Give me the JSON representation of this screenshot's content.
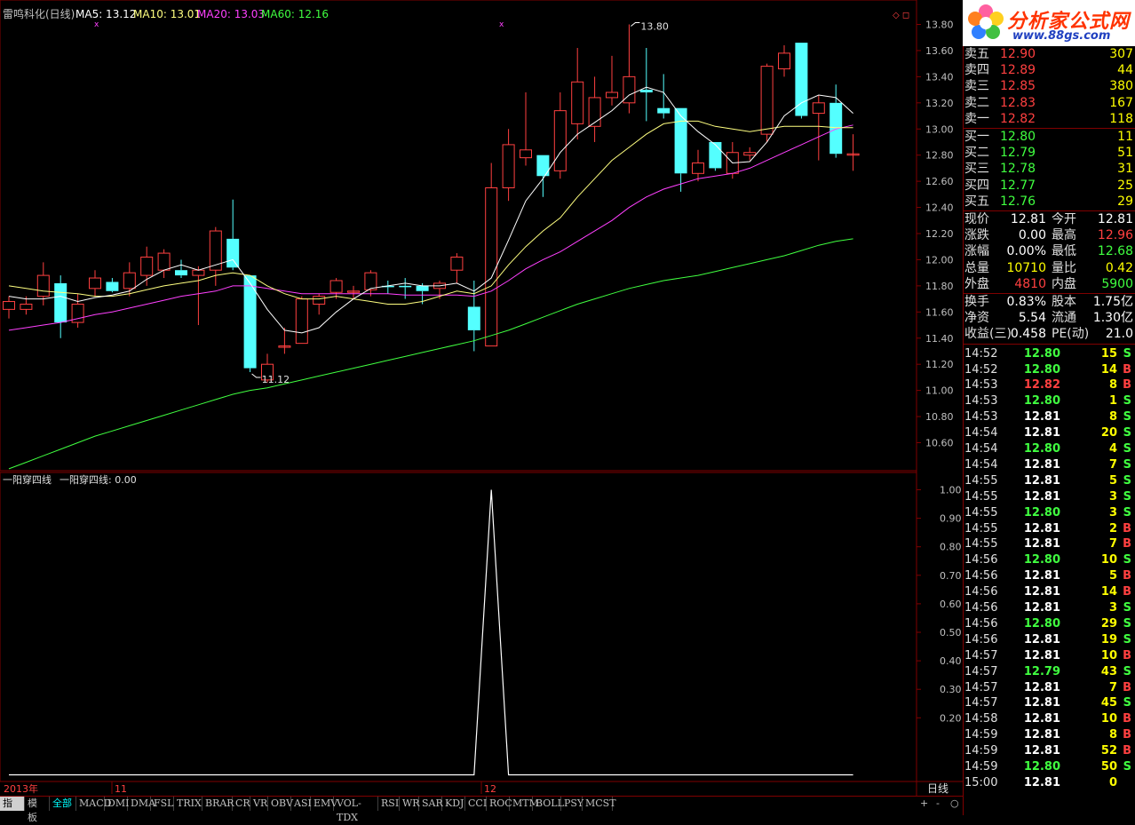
{
  "header": {
    "stock": "雷鸣科化(日线)",
    "ma5": "MA5: 13.12",
    "ma10": "MA10: 13.01",
    "ma20": "MA20: 13.03",
    "ma60": "MA60: 12.16",
    "marker": "◇ ◻"
  },
  "colors": {
    "up": "#ff4040",
    "down": "#54ffff",
    "ma5": "#ffffff",
    "ma10": "#ffff80",
    "ma20": "#ff40ff",
    "ma60": "#40ff40",
    "grid": "#800000"
  },
  "chart_data": [
    {
      "type": "candlestick",
      "title": "雷鸣科化(日线)",
      "ylim": [
        10.4,
        13.9
      ],
      "y_ticks": [
        "13.80",
        "13.60",
        "13.40",
        "13.20",
        "13.00",
        "12.80",
        "12.60",
        "12.40",
        "12.20",
        "12.00",
        "11.80",
        "11.60",
        "11.40",
        "11.20",
        "11.00",
        "10.80",
        "10.60"
      ],
      "annotations": [
        {
          "label": "13.80"
        },
        {
          "label": "11.12"
        }
      ],
      "candles": [
        {
          "o": 11.62,
          "h": 11.72,
          "l": 11.55,
          "c": 11.68
        },
        {
          "o": 11.62,
          "h": 11.72,
          "l": 11.58,
          "c": 11.66
        },
        {
          "o": 11.72,
          "h": 11.98,
          "l": 11.65,
          "c": 11.88
        },
        {
          "o": 11.82,
          "h": 11.88,
          "l": 11.4,
          "c": 11.52
        },
        {
          "o": 11.52,
          "h": 11.74,
          "l": 11.48,
          "c": 11.66
        },
        {
          "o": 11.78,
          "h": 11.92,
          "l": 11.72,
          "c": 11.86
        },
        {
          "o": 11.83,
          "h": 11.86,
          "l": 11.75,
          "c": 11.76
        },
        {
          "o": 11.78,
          "h": 11.98,
          "l": 11.72,
          "c": 11.9
        },
        {
          "o": 11.88,
          "h": 12.1,
          "l": 11.8,
          "c": 12.02
        },
        {
          "o": 11.92,
          "h": 12.08,
          "l": 11.86,
          "c": 12.05
        },
        {
          "o": 11.92,
          "h": 12.0,
          "l": 11.86,
          "c": 11.88
        },
        {
          "o": 11.88,
          "h": 11.95,
          "l": 11.5,
          "c": 11.92
        },
        {
          "o": 11.92,
          "h": 12.25,
          "l": 11.8,
          "c": 12.22
        },
        {
          "o": 12.16,
          "h": 12.46,
          "l": 11.92,
          "c": 11.94
        },
        {
          "o": 11.88,
          "h": 11.88,
          "l": 11.14,
          "c": 11.17
        },
        {
          "o": 11.08,
          "h": 11.28,
          "l": 11.06,
          "c": 11.2
        },
        {
          "o": 11.34,
          "h": 11.48,
          "l": 11.28,
          "c": 11.34
        },
        {
          "o": 11.36,
          "h": 11.72,
          "l": 11.36,
          "c": 11.7
        },
        {
          "o": 11.66,
          "h": 11.74,
          "l": 11.58,
          "c": 11.72
        },
        {
          "o": 11.75,
          "h": 11.86,
          "l": 11.7,
          "c": 11.84
        },
        {
          "o": 11.76,
          "h": 11.8,
          "l": 11.7,
          "c": 11.76
        },
        {
          "o": 11.77,
          "h": 11.92,
          "l": 11.72,
          "c": 11.9
        },
        {
          "o": 11.8,
          "h": 11.84,
          "l": 11.74,
          "c": 11.79
        },
        {
          "o": 11.8,
          "h": 11.86,
          "l": 11.7,
          "c": 11.79
        },
        {
          "o": 11.8,
          "h": 11.82,
          "l": 11.66,
          "c": 11.76
        },
        {
          "o": 11.78,
          "h": 11.84,
          "l": 11.7,
          "c": 11.82
        },
        {
          "o": 11.92,
          "h": 12.05,
          "l": 11.82,
          "c": 12.02
        },
        {
          "o": 11.64,
          "h": 11.84,
          "l": 11.3,
          "c": 11.46
        },
        {
          "o": 11.34,
          "h": 12.74,
          "l": 11.34,
          "c": 12.55
        },
        {
          "o": 12.55,
          "h": 13.0,
          "l": 12.45,
          "c": 12.88
        },
        {
          "o": 12.78,
          "h": 13.28,
          "l": 12.72,
          "c": 12.84
        },
        {
          "o": 12.8,
          "h": 12.8,
          "l": 12.48,
          "c": 12.64
        },
        {
          "o": 12.68,
          "h": 13.28,
          "l": 12.62,
          "c": 13.14
        },
        {
          "o": 13.04,
          "h": 13.62,
          "l": 12.92,
          "c": 13.36
        },
        {
          "o": 13.02,
          "h": 13.4,
          "l": 12.9,
          "c": 13.24
        },
        {
          "o": 13.24,
          "h": 13.56,
          "l": 13.18,
          "c": 13.28
        },
        {
          "o": 13.2,
          "h": 13.8,
          "l": 13.12,
          "c": 13.4
        },
        {
          "o": 13.3,
          "h": 13.62,
          "l": 13.06,
          "c": 13.28
        },
        {
          "o": 13.16,
          "h": 13.42,
          "l": 13.08,
          "c": 13.12
        },
        {
          "o": 13.16,
          "h": 13.16,
          "l": 12.52,
          "c": 12.66
        },
        {
          "o": 12.66,
          "h": 12.84,
          "l": 12.6,
          "c": 12.74
        },
        {
          "o": 12.9,
          "h": 12.9,
          "l": 12.68,
          "c": 12.7
        },
        {
          "o": 12.66,
          "h": 12.9,
          "l": 12.62,
          "c": 12.82
        },
        {
          "o": 12.8,
          "h": 12.86,
          "l": 12.76,
          "c": 12.82
        },
        {
          "o": 12.96,
          "h": 13.5,
          "l": 12.9,
          "c": 13.48
        },
        {
          "o": 13.46,
          "h": 13.64,
          "l": 13.4,
          "c": 13.58
        },
        {
          "o": 13.66,
          "h": 13.66,
          "l": 13.08,
          "c": 13.1
        },
        {
          "o": 13.12,
          "h": 13.26,
          "l": 12.76,
          "c": 13.2
        },
        {
          "o": 13.2,
          "h": 13.34,
          "l": 12.78,
          "c": 12.81
        },
        {
          "o": 12.81,
          "h": 12.96,
          "l": 12.68,
          "c": 12.81
        }
      ],
      "ma5": [
        11.72,
        11.7,
        11.7,
        11.72,
        11.68,
        11.71,
        11.73,
        11.76,
        11.85,
        11.92,
        11.96,
        11.92,
        11.96,
        12.0,
        11.82,
        11.62,
        11.46,
        11.44,
        11.48,
        11.6,
        11.7,
        11.78,
        11.8,
        11.82,
        11.8,
        11.8,
        11.82,
        11.76,
        11.86,
        12.15,
        12.45,
        12.62,
        12.82,
        12.96,
        13.05,
        13.14,
        13.26,
        13.32,
        13.28,
        13.1,
        12.98,
        12.88,
        12.74,
        12.75,
        12.9,
        13.1,
        13.2,
        13.26,
        13.24,
        13.12
      ],
      "ma10": [
        11.8,
        11.78,
        11.76,
        11.75,
        11.74,
        11.72,
        11.72,
        11.74,
        11.77,
        11.8,
        11.82,
        11.84,
        11.88,
        11.9,
        11.88,
        11.8,
        11.74,
        11.7,
        11.7,
        11.72,
        11.7,
        11.68,
        11.66,
        11.66,
        11.68,
        11.72,
        11.76,
        11.74,
        11.8,
        11.96,
        12.1,
        12.22,
        12.32,
        12.48,
        12.62,
        12.76,
        12.86,
        12.96,
        13.04,
        13.06,
        13.06,
        13.02,
        13.0,
        12.98,
        13.0,
        13.02,
        13.02,
        13.02,
        13.01,
        13.01
      ],
      "ma20": [
        11.46,
        11.48,
        11.5,
        11.52,
        11.55,
        11.58,
        11.6,
        11.63,
        11.66,
        11.69,
        11.72,
        11.74,
        11.76,
        11.8,
        11.8,
        11.78,
        11.76,
        11.74,
        11.74,
        11.74,
        11.74,
        11.74,
        11.74,
        11.73,
        11.73,
        11.73,
        11.73,
        11.72,
        11.76,
        11.84,
        11.93,
        12.0,
        12.06,
        12.14,
        12.22,
        12.3,
        12.4,
        12.48,
        12.54,
        12.58,
        12.62,
        12.64,
        12.66,
        12.7,
        12.76,
        12.82,
        12.88,
        12.94,
        13.0,
        13.03
      ],
      "ma60": [
        10.4,
        10.45,
        10.5,
        10.55,
        10.6,
        10.65,
        10.69,
        10.73,
        10.77,
        10.81,
        10.85,
        10.89,
        10.93,
        10.97,
        11.0,
        11.02,
        11.05,
        11.08,
        11.11,
        11.14,
        11.17,
        11.2,
        11.23,
        11.26,
        11.29,
        11.32,
        11.35,
        11.38,
        11.42,
        11.46,
        11.51,
        11.56,
        11.61,
        11.66,
        11.7,
        11.74,
        11.78,
        11.81,
        11.84,
        11.86,
        11.88,
        11.91,
        11.94,
        11.97,
        12.0,
        12.03,
        12.07,
        12.11,
        12.14,
        12.16
      ]
    },
    {
      "type": "line",
      "title": "一阳穿四线",
      "legend": "一阳穿四线: 0.00",
      "ylim": [
        0,
        1.05
      ],
      "y_ticks": [
        "1.00",
        "0.90",
        "0.80",
        "0.70",
        "0.60",
        "0.50",
        "0.40",
        "0.30",
        "0.20"
      ],
      "values": [
        0,
        0,
        0,
        0,
        0,
        0,
        0,
        0,
        0,
        0,
        0,
        0,
        0,
        0,
        0,
        0,
        0,
        0,
        0,
        0,
        0,
        0,
        0,
        0,
        0,
        0,
        0,
        0,
        1,
        0,
        0,
        0,
        0,
        0,
        0,
        0,
        0,
        0,
        0,
        0,
        0,
        0,
        0,
        0,
        0,
        0,
        0,
        0,
        0,
        0
      ]
    }
  ],
  "x_axis": {
    "labels": [
      "2013年",
      "11",
      "12"
    ],
    "period": "日线"
  },
  "tabs": [
    "指标",
    "模板",
    "全部",
    "MACD",
    "DMI",
    "DMA",
    "FSL",
    "TRIX",
    "BRAR",
    "CR",
    "VR",
    "OBV",
    "ASI",
    "EMV",
    "VOL-TDX",
    "RSI",
    "WR",
    "SAR",
    "KDJ",
    "CCI",
    "ROC",
    "MTM",
    "BOLL",
    "PSY",
    "MCST"
  ],
  "tab_controls": [
    "+",
    "-",
    "○"
  ],
  "logo": {
    "title": "分析家公式网",
    "url": "www.88gs.com"
  },
  "order_book": {
    "asks": [
      {
        "label": "卖五",
        "price": "12.90",
        "vol": "307"
      },
      {
        "label": "卖四",
        "price": "12.89",
        "vol": "44"
      },
      {
        "label": "卖三",
        "price": "12.85",
        "vol": "380"
      },
      {
        "label": "卖二",
        "price": "12.83",
        "vol": "167"
      },
      {
        "label": "卖一",
        "price": "12.82",
        "vol": "118"
      }
    ],
    "bids": [
      {
        "label": "买一",
        "price": "12.80",
        "vol": "11"
      },
      {
        "label": "买二",
        "price": "12.79",
        "vol": "51"
      },
      {
        "label": "买三",
        "price": "12.78",
        "vol": "31"
      },
      {
        "label": "买四",
        "price": "12.77",
        "vol": "25"
      },
      {
        "label": "买五",
        "price": "12.76",
        "vol": "29"
      }
    ]
  },
  "quote": [
    {
      "l1": "现价",
      "v1": "12.81",
      "l2": "今开",
      "v2": "12.81"
    },
    {
      "l1": "涨跌",
      "v1": "0.00",
      "l2": "最高",
      "v2": "12.96"
    },
    {
      "l1": "涨幅",
      "v1": "0.00%",
      "l2": "最低",
      "v2": "12.68"
    },
    {
      "l1": "总量",
      "v1": "10710",
      "l2": "量比",
      "v2": "0.42"
    },
    {
      "l1": "外盘",
      "v1": "4810",
      "l2": "内盘",
      "v2": "5900"
    }
  ],
  "stats": [
    {
      "l1": "换手",
      "v1": "0.83%",
      "l2": "股本",
      "v2": "1.75亿"
    },
    {
      "l1": "净资",
      "v1": "5.54",
      "l2": "流通",
      "v2": "1.30亿"
    },
    {
      "l1": "收益(三)",
      "v1": "0.458",
      "l2": "PE(动)",
      "v2": "21.0"
    }
  ],
  "ticks": [
    {
      "t": "14:52",
      "p": "12.80",
      "v": "15",
      "s": "S"
    },
    {
      "t": "14:52",
      "p": "12.80",
      "v": "14",
      "s": "B"
    },
    {
      "t": "14:53",
      "p": "12.82",
      "v": "8",
      "s": "B"
    },
    {
      "t": "14:53",
      "p": "12.80",
      "v": "1",
      "s": "S"
    },
    {
      "t": "14:53",
      "p": "12.81",
      "v": "8",
      "s": "S"
    },
    {
      "t": "14:54",
      "p": "12.81",
      "v": "20",
      "s": "S"
    },
    {
      "t": "14:54",
      "p": "12.80",
      "v": "4",
      "s": "S"
    },
    {
      "t": "14:54",
      "p": "12.81",
      "v": "7",
      "s": "S"
    },
    {
      "t": "14:55",
      "p": "12.81",
      "v": "5",
      "s": "S"
    },
    {
      "t": "14:55",
      "p": "12.81",
      "v": "3",
      "s": "S"
    },
    {
      "t": "14:55",
      "p": "12.80",
      "v": "3",
      "s": "S"
    },
    {
      "t": "14:55",
      "p": "12.81",
      "v": "2",
      "s": "B"
    },
    {
      "t": "14:55",
      "p": "12.81",
      "v": "7",
      "s": "B"
    },
    {
      "t": "14:56",
      "p": "12.80",
      "v": "10",
      "s": "S"
    },
    {
      "t": "14:56",
      "p": "12.81",
      "v": "5",
      "s": "B"
    },
    {
      "t": "14:56",
      "p": "12.81",
      "v": "14",
      "s": "B"
    },
    {
      "t": "14:56",
      "p": "12.81",
      "v": "3",
      "s": "S"
    },
    {
      "t": "14:56",
      "p": "12.80",
      "v": "29",
      "s": "S"
    },
    {
      "t": "14:56",
      "p": "12.81",
      "v": "19",
      "s": "S"
    },
    {
      "t": "14:57",
      "p": "12.81",
      "v": "10",
      "s": "B"
    },
    {
      "t": "14:57",
      "p": "12.79",
      "v": "43",
      "s": "S"
    },
    {
      "t": "14:57",
      "p": "12.81",
      "v": "7",
      "s": "B"
    },
    {
      "t": "14:57",
      "p": "12.81",
      "v": "45",
      "s": "S"
    },
    {
      "t": "14:58",
      "p": "12.81",
      "v": "10",
      "s": "B"
    },
    {
      "t": "14:59",
      "p": "12.81",
      "v": "8",
      "s": "B"
    },
    {
      "t": "14:59",
      "p": "12.81",
      "v": "52",
      "s": "B"
    },
    {
      "t": "14:59",
      "p": "12.80",
      "v": "50",
      "s": "S"
    },
    {
      "t": "15:00",
      "p": "12.81",
      "v": "0",
      "s": ""
    }
  ],
  "ref_price": 12.81
}
